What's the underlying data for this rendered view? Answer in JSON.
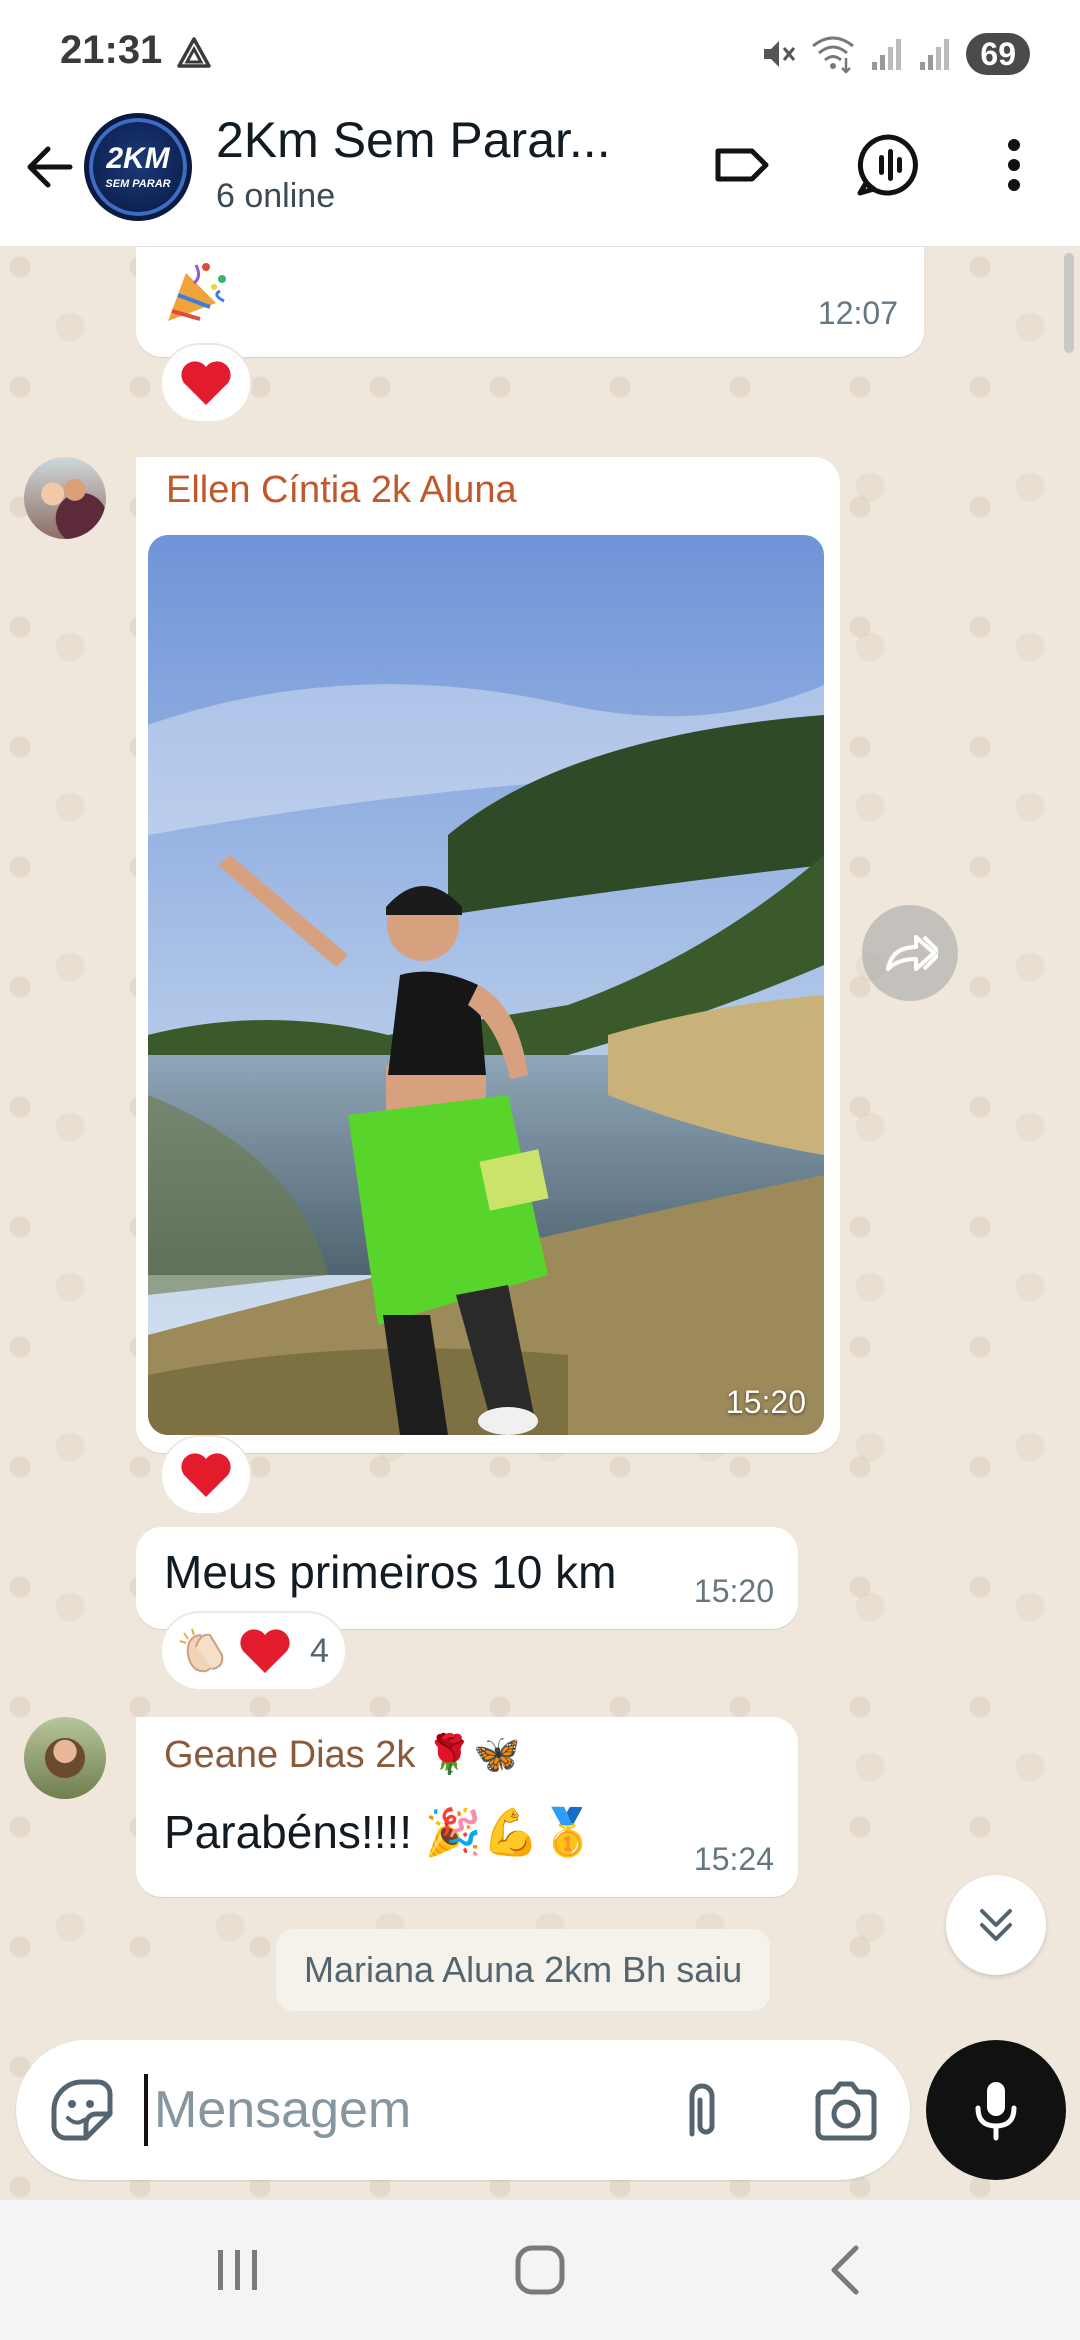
{
  "status_bar": {
    "time": "21:31",
    "battery": "69"
  },
  "header": {
    "title": "2Km Sem Parar...",
    "subtitle": "6 online",
    "avatar_big": "2KM",
    "avatar_small": "SEM PARAR"
  },
  "messages": {
    "first": {
      "time": "12:07",
      "reaction": "❤️"
    },
    "photo": {
      "sender": "Ellen Cíntia 2k Aluna",
      "sender_color": "#c0582c",
      "time": "15:20",
      "reaction": "❤️"
    },
    "text1": {
      "text": "Meus primeiros 10 km",
      "time": "15:20",
      "reaction_count": "4"
    },
    "text2": {
      "sender": "Geane Dias 2k 🌹🦋",
      "sender_color": "#8a5a3b",
      "text": "Parabéns!!!! 🎉💪🥇",
      "time": "15:24"
    },
    "system": "Mariana Aluna 2km Bh saiu"
  },
  "input": {
    "placeholder": "Mensagem"
  },
  "colors": {
    "chat_bg": "#efe7dc",
    "bubble": "#ffffff",
    "timestamp": "#667781",
    "mic_button": "#111111"
  },
  "icons": [
    "back-arrow-icon",
    "label-icon",
    "voice-chat-icon",
    "more-vertical-icon",
    "forward-icon",
    "chevrons-down-icon",
    "sticker-icon",
    "attach-icon",
    "camera-icon",
    "mic-icon",
    "recents-icon",
    "home-icon",
    "back-icon"
  ]
}
